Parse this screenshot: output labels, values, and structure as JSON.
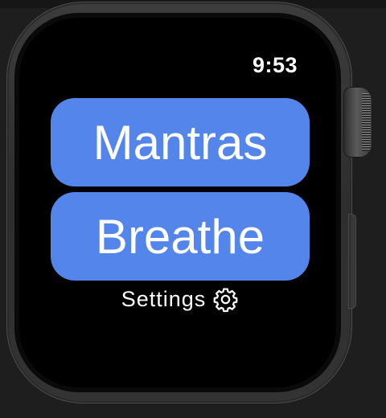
{
  "status": {
    "time": "9:53"
  },
  "buttons": {
    "mantras_label": "Mantras",
    "breathe_label": "Breathe"
  },
  "settings": {
    "label": "Settings",
    "icon": "gear-icon"
  },
  "colors": {
    "button_background": "#5385ea",
    "screen_background": "#000000",
    "text": "#ffffff"
  }
}
